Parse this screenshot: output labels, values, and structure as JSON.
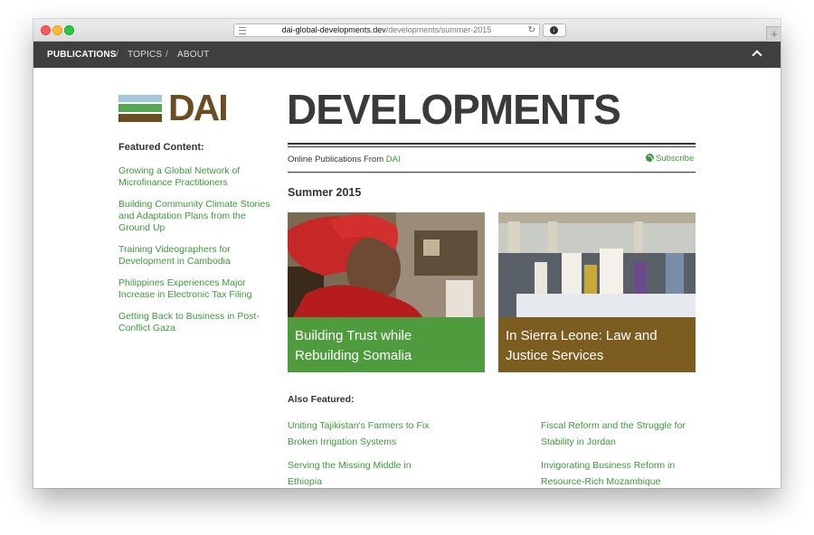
{
  "browser": {
    "url_host": "dai-global-developments.dev",
    "url_path": "/developments/summer-2015",
    "new_tab_label": "+"
  },
  "nav": {
    "items": [
      "PUBLICATIONS",
      "TOPICS",
      "ABOUT"
    ],
    "separator": "/"
  },
  "logo": {
    "text": "DAI"
  },
  "sidebar": {
    "label": "Featured Content:",
    "links": [
      "Growing a Global Network of Microfinance Practitioners",
      "Building Community Climate Stories and Adaptation Plans from the Ground Up",
      "Training Videographers for Development in Cambodia",
      "Philippines Experiences Major Increase in Electronic Tax Filing",
      "Getting Back to Business in Post-Conflict Gaza"
    ]
  },
  "header": {
    "title": "DEVELOPMENTS",
    "tagline_prefix": "Online Publications From ",
    "tagline_brand": "DAI",
    "subscribe": "Subscribe"
  },
  "issue": "Summer 2015",
  "cards": [
    {
      "title": "Building Trust while Rebuilding Somalia",
      "color": "#4e9c3e"
    },
    {
      "title": "In Sierra Leone: Law and Justice Services",
      "color": "#7d5c1f"
    }
  ],
  "also": {
    "label": "Also Featured:",
    "links": [
      "Uniting Tajikistan's Farmers to Fix Broken Irrigation Systems",
      "Fiscal Reform and the Struggle for Stability in Jordan",
      "Serving the Missing Middle in Ethiopia",
      "Invigorating Business Reform in Resource-Rich Mozambique"
    ]
  },
  "colors": {
    "accent": "#3c9a3c",
    "nav_bg": "#3f3f3f",
    "logo_brown": "#6b4d24"
  }
}
